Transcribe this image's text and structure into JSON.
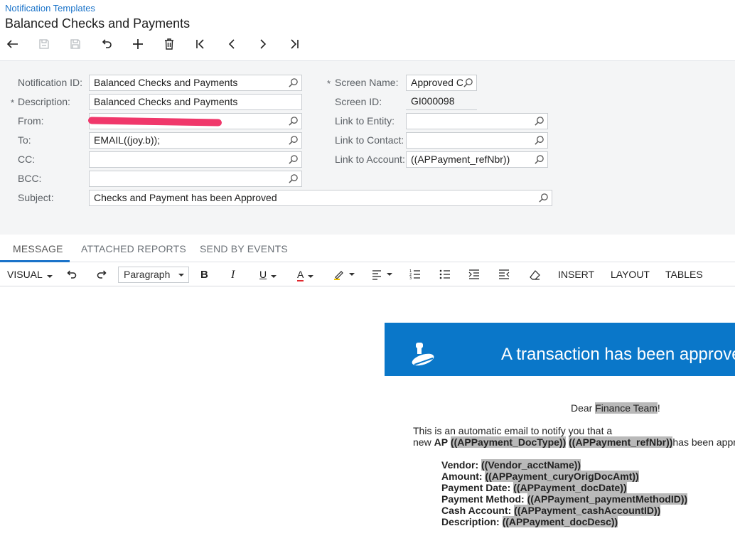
{
  "header": {
    "breadcrumb": "Notification Templates",
    "title": "Balanced Checks and Payments"
  },
  "toolbar": {
    "buttons": [
      "back",
      "save-close",
      "save",
      "undo",
      "add",
      "delete",
      "first",
      "previous",
      "next",
      "last"
    ],
    "icon_color": "#222222",
    "disabled_color": "#b8bcc0"
  },
  "form": {
    "notification_id_label": "Notification ID:",
    "notification_id_value": "Balanced Checks and Payments",
    "description_label": "Description:",
    "description_value": "Balanced Checks and Payments",
    "from_label": "From:",
    "from_value": "",
    "to_label": "To:",
    "to_value": "EMAIL((joy.b));",
    "cc_label": "CC:",
    "cc_value": "",
    "bcc_label": "BCC:",
    "bcc_value": "",
    "subject_label": "Subject:",
    "subject_value": "Checks and Payment has been Approved",
    "screen_name_label": "Screen Name:",
    "screen_name_value": "Approved Ch",
    "screen_id_label": "Screen ID:",
    "screen_id_value": "GI000098",
    "link_entity_label": "Link to Entity:",
    "link_entity_value": "",
    "link_contact_label": "Link to Contact:",
    "link_contact_value": "",
    "link_account_label": "Link to Account:",
    "link_account_value": "((APPayment_refNbr))",
    "required_marker": "*",
    "redaction_color": "#f0386b"
  },
  "tabs": {
    "message": "MESSAGE",
    "attached_reports": "ATTACHED REPORTS",
    "send_by_events": "SEND BY EVENTS",
    "active": "message",
    "accent": "#1a73c9"
  },
  "editor_toolbar": {
    "visual": "VISUAL",
    "paragraph": "Paragraph",
    "insert": "INSERT",
    "layout": "LAYOUT",
    "tables": "TABLES"
  },
  "email": {
    "banner_title": "A transaction has been approve",
    "banner_color": "#0a77c9",
    "greeting_prefix": "Dear ",
    "greeting_name": "Finance Team",
    "greeting_suffix": "!",
    "intro_line1": "This is an automatic email to notify you that a",
    "intro_line2_prefix": "new ",
    "intro_ap": "AP",
    "intro_doctype": "((APPayment_DocType))",
    "intro_refnbr": "((APPayment_refNbr))",
    "intro_suffix": "has been appr",
    "fields": [
      {
        "label": "Vendor:",
        "value": "((Vendor_acctName))"
      },
      {
        "label": "Amount:",
        "value": "((APPayment_curyOrigDocAmt))"
      },
      {
        "label": "Payment Date:",
        "value": "((APPayment_docDate))"
      },
      {
        "label": "Payment Method:",
        "value": "((APPayment_paymentMethodID))"
      },
      {
        "label": "Cash Account:",
        "value": "((APPayment_cashAccountID))"
      },
      {
        "label": "Description:",
        "value": "((APPayment_docDesc))"
      }
    ],
    "highlight_color": "#b9b9b9"
  }
}
